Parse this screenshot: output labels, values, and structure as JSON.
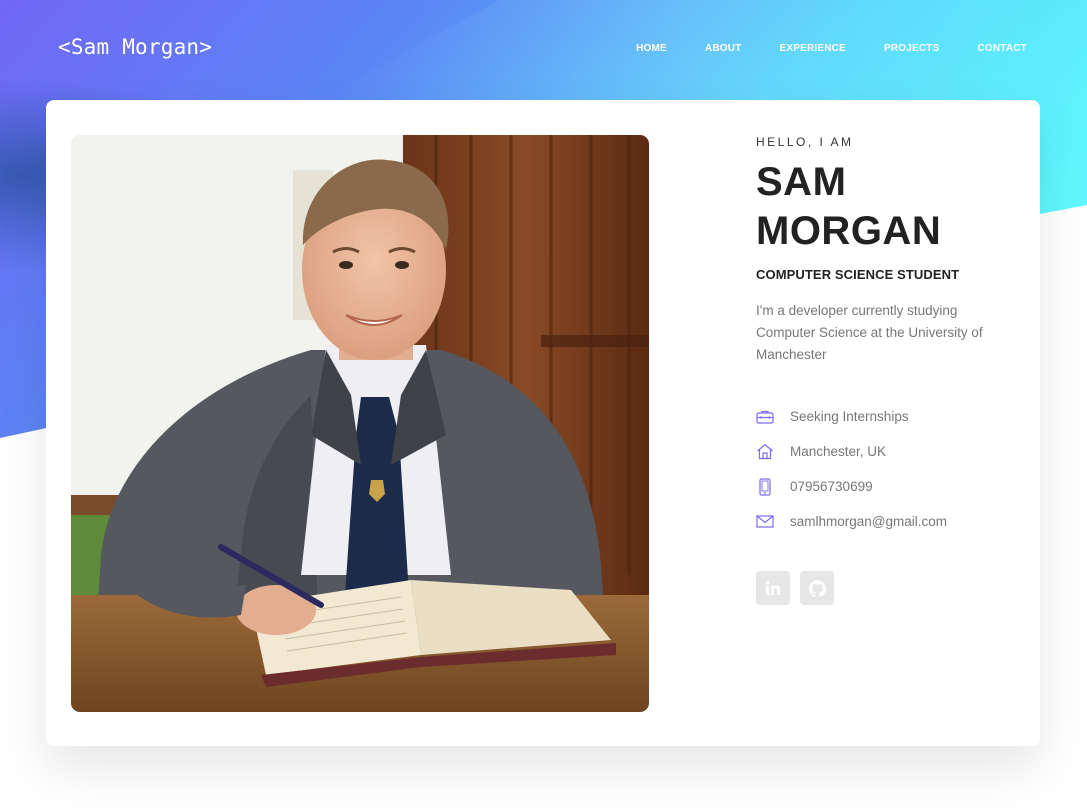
{
  "header": {
    "logo": "<Sam Morgan>",
    "nav": [
      "HOME",
      "ABOUT",
      "EXPERIENCE",
      "PROJECTS",
      "CONTACT"
    ]
  },
  "profile": {
    "greeting": "HELLO, I AM",
    "first_name": "SAM",
    "last_name": "MORGAN",
    "role": "COMPUTER SCIENCE STUDENT",
    "bio": "I'm a developer currently studying Computer Science at the University of Manchester",
    "details": {
      "status": "Seeking Internships",
      "location": "Manchester, UK",
      "phone": "07956730699",
      "email": "samlhmorgan@gmail.com"
    },
    "socials": [
      "linkedin-icon",
      "github-icon"
    ]
  },
  "colors": {
    "accent": "#7b6cf0",
    "gradient_start": "#6d64f5",
    "gradient_end": "#5ef8fd",
    "heading": "#222222",
    "muted": "#777777"
  }
}
